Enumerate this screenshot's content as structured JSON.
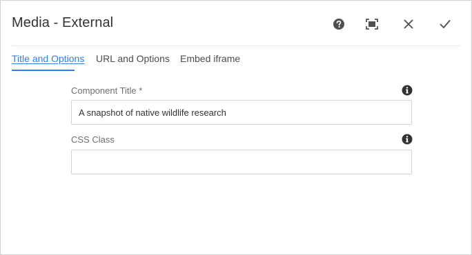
{
  "dialog": {
    "title": "Media - External",
    "actions": {
      "help": "help-icon",
      "fullscreen": "fullscreen-icon",
      "close": "close-icon",
      "done": "checkmark-icon"
    }
  },
  "tabs": [
    {
      "label": "Title and Options",
      "selected": true
    },
    {
      "label": "URL and Options",
      "selected": false
    },
    {
      "label": "Embed iframe",
      "selected": false
    }
  ],
  "fields": {
    "component_title": {
      "label": "Component Title *",
      "value": "A snapshot of native wildlife research"
    },
    "css_class": {
      "label": "CSS Class",
      "value": ""
    }
  },
  "colors": {
    "accent": "#2680eb",
    "icon": "#505050",
    "border": "#d3d3d3"
  }
}
